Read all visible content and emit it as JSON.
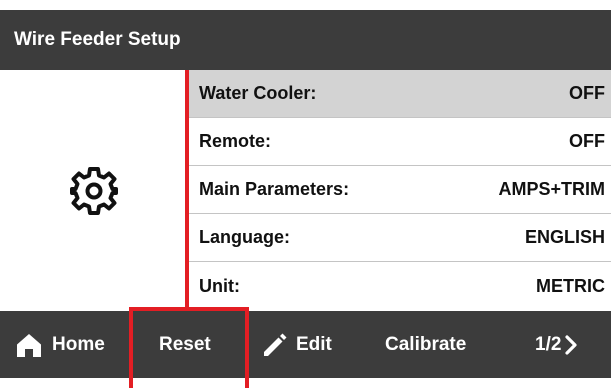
{
  "header": {
    "title": "Wire Feeder Setup"
  },
  "side_icon": "gear-icon",
  "settings": [
    {
      "label": "Water Cooler:",
      "value": "OFF",
      "selected": true
    },
    {
      "label": "Remote:",
      "value": "OFF"
    },
    {
      "label": "Main Parameters:",
      "value": "AMPS+TRIM"
    },
    {
      "label": "Language:",
      "value": "ENGLISH"
    },
    {
      "label": "Unit:",
      "value": "METRIC"
    }
  ],
  "bottom_bar": {
    "home": {
      "icon": "home-icon",
      "label": "Home"
    },
    "reset": {
      "label": "Reset"
    },
    "edit": {
      "icon": "pencil-icon",
      "label": "Edit"
    },
    "calibrate": {
      "label": "Calibrate"
    },
    "page": {
      "label": "1/2",
      "icon": "chevron-right-icon"
    }
  },
  "colors": {
    "bar_background": "#3c3c3c",
    "selected_row": "#d3d3d3",
    "highlight_red": "#e31e24",
    "text": "#111111"
  }
}
